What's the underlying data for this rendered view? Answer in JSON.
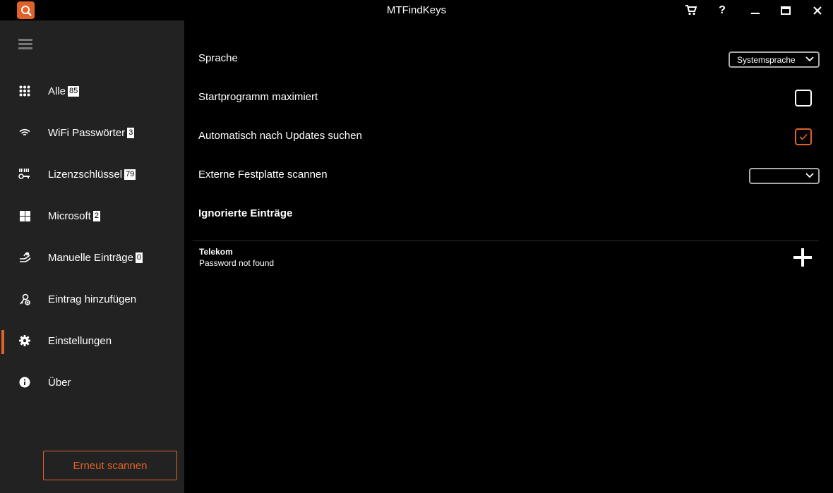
{
  "window": {
    "title": "MTFindKeys",
    "buttons": [
      "cart-icon",
      "help-icon",
      "minimize-icon",
      "maximize-icon",
      "close-icon"
    ],
    "help_label": "?"
  },
  "sidebar": {
    "items": [
      {
        "label": "Alle",
        "badge": "85",
        "icon": "grid-icon"
      },
      {
        "label": "WiFi Passwörter",
        "badge": "3",
        "icon": "wifi-icon"
      },
      {
        "label": "Lizenzschlüssel",
        "badge": "79",
        "icon": "key-barcode-icon"
      },
      {
        "label": "Microsoft",
        "badge": "2",
        "icon": "windows-icon"
      },
      {
        "label": "Manuelle Einträge",
        "badge": "0",
        "icon": "hand-icon"
      },
      {
        "label": "Eintrag hinzufügen",
        "badge": null,
        "icon": "add-entry-icon"
      },
      {
        "label": "Einstellungen",
        "badge": null,
        "icon": "gear-icon",
        "active": true
      },
      {
        "label": "Über",
        "badge": null,
        "icon": "info-icon"
      }
    ],
    "rescan_label": "Erneut scannen"
  },
  "settings": {
    "language_label": "Sprache",
    "language_value": "Systemsprache",
    "start_maximized_label": "Startprogramm maximiert",
    "start_maximized_checked": false,
    "auto_update_label": "Automatisch nach Updates suchen",
    "auto_update_checked": true,
    "external_drive_label": "Externe Festplatte scannen",
    "external_drive_value": ""
  },
  "ignored": {
    "title": "Ignorierte Einträge",
    "entries": [
      {
        "name": "Telekom",
        "detail": "Password not found"
      }
    ]
  },
  "colors": {
    "accent": "#e0622a",
    "sidebar_bg": "#222222",
    "content_bg": "#000000"
  }
}
